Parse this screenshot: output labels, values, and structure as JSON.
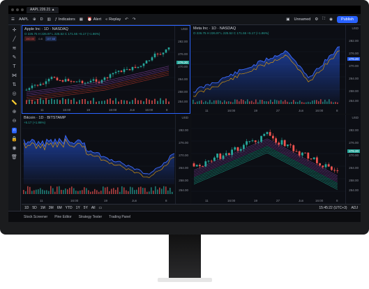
{
  "browser": {
    "tab_label": "AAPL 226.21 ▲"
  },
  "toolbar": {
    "symbol": "AAPL",
    "interval": "D",
    "indicators_label": "Indicators",
    "alert_label": "Alert",
    "replay_label": "Replay",
    "layout_label": "Unnamed",
    "publish_label": "Publish"
  },
  "panes": [
    {
      "title": "Apple Inc · 1D · NASDAQ",
      "sub": "O 226.75  H 226.97  L 225.52  C 171.55  +5.17 (+1.86%)",
      "bid": "150.00",
      "ask": "157.68",
      "ticks_y": [
        "USD",
        "282.00",
        "276.00",
        "270.00",
        "264.00",
        "258.00",
        "254.00"
      ],
      "price_tag": "276.20",
      "ticks_x": [
        "11",
        "16:00",
        "19",
        "16:00",
        "Jun",
        "16:00",
        "8"
      ],
      "accent": "#26a69a"
    },
    {
      "title": "Meta Inc · 1D · NASDAQ",
      "sub": "O 226.75  H 226.97  L 225.52  C 171.55  +5.17 (+1.86%)",
      "ticks_y": [
        "USD",
        "282.00",
        "276.00",
        "270.00",
        "264.00",
        "258.00",
        "254.00"
      ],
      "price_tag": "276.20",
      "ticks_x": [
        "11",
        "16:00",
        "19",
        "27",
        "Jun",
        "16:00",
        "8"
      ],
      "accent": "#2962ff"
    },
    {
      "title": "Bitcoin · 1D · BITSTAMP",
      "sub": "+5.17 (+1.86%)",
      "ticks_y": [
        "USD",
        "282.00",
        "276.00",
        "270.00",
        "264.00",
        "258.00",
        "254.00"
      ],
      "ticks_x": [
        "11",
        "16:00",
        "19",
        "Jun",
        "8"
      ],
      "accent": "#2962ff"
    },
    {
      "title": "",
      "sub": "",
      "ticks_y": [
        "USD",
        "282.00",
        "276.00",
        "270.00",
        "264.00",
        "258.00",
        "254.00"
      ],
      "price_tag": "276.20",
      "ticks_x": [
        "11",
        "16:00",
        "19",
        "27",
        "Jun",
        "16:00",
        "8"
      ],
      "accent": "#26a69a"
    }
  ],
  "range_buttons": [
    "1D",
    "5D",
    "1M",
    "3M",
    "6M",
    "YTD",
    "1Y",
    "5Y",
    "All"
  ],
  "clock": "15:45:22 (UTC+3)",
  "adj": "ADJ",
  "panel_tabs": [
    "Stock Screener",
    "Pine Editor",
    "Strategy Tester",
    "Trading Panel"
  ],
  "colors": {
    "up": "#26a69a",
    "down": "#ef5350",
    "accent": "#2962ff",
    "area": "#1e3a8a"
  }
}
